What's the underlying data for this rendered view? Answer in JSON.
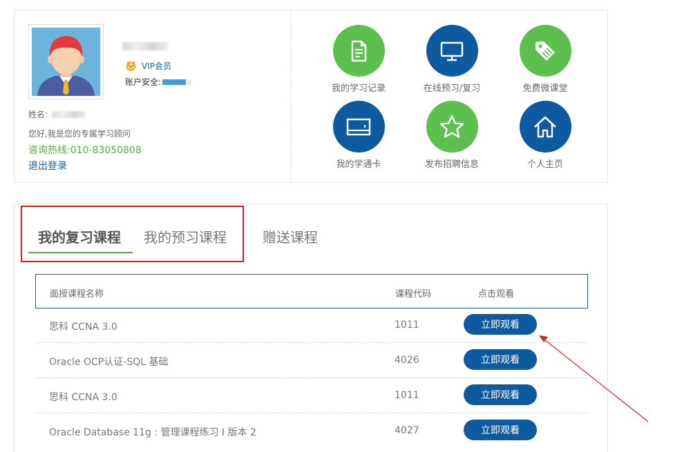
{
  "profile": {
    "vip_label": "VIP会员",
    "security_label": "账户安全:",
    "name_label": "姓名:",
    "advisor_text": "您好,我是您的专属学习顾问",
    "hotline_text": "咨询热线:010-83050808",
    "logout_label": "退出登录"
  },
  "shortcuts": [
    {
      "label": "我的学习记录",
      "icon": "document-icon",
      "color": "#5cbf4e"
    },
    {
      "label": "在线预习/复习",
      "icon": "monitor-icon",
      "color": "#0d5aa0"
    },
    {
      "label": "免费微课堂",
      "icon": "tag-icon",
      "color": "#5cbf4e"
    },
    {
      "label": "我的学通卡",
      "icon": "card-icon",
      "color": "#0d5aa0"
    },
    {
      "label": "发布招聘信息",
      "icon": "star-icon",
      "color": "#5cbf4e"
    },
    {
      "label": "个人主页",
      "icon": "home-icon",
      "color": "#0d5aa0"
    }
  ],
  "tabs": {
    "review": "我的复习课程",
    "preview": "我的预习课程",
    "gift": "赠送课程"
  },
  "table": {
    "headers": {
      "name": "面授课程名称",
      "code": "课程代码",
      "action": "点击观看"
    },
    "rows": [
      {
        "name": "思科 CCNA 3.0",
        "code": "1011",
        "button": "立即观看"
      },
      {
        "name": "Oracle OCP认证-SQL 基础",
        "code": "4026",
        "button": "立即观看"
      },
      {
        "name": "思科 CCNA 3.0",
        "code": "1011",
        "button": "立即观看"
      },
      {
        "name": "Oracle Database 11g : 管理课程练习 I 版本 2",
        "code": "4027",
        "button": "立即观看"
      }
    ]
  },
  "colors": {
    "accent_green": "#52b43b",
    "accent_blue": "#0d5aa0",
    "annotation_red": "#e01b1b"
  }
}
